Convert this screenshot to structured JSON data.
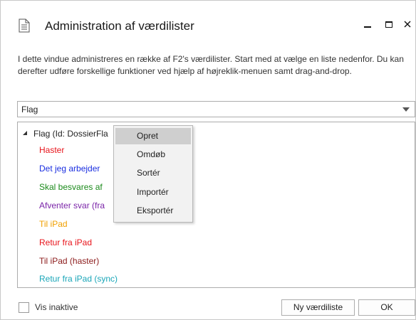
{
  "window": {
    "title": "Administration af værdilister",
    "doc_icon": "document-icon",
    "controls": {
      "minimize": "minimize-icon",
      "maximize": "maximize-icon",
      "close": "close-icon"
    }
  },
  "description": "I dette vindue administreres en række af F2's værdilister. Start med at vælge en liste nedenfor. Du kan derefter udføre forskellige funktioner ved hjælp af højreklik-menuen samt drag-and-drop.",
  "list_select": {
    "value": "Flag",
    "chevron_icon": "chevron-down-icon"
  },
  "tree": {
    "root_label": "Flag (Id: DossierFla",
    "toggle_icon": "expand-triangle-icon",
    "items": [
      {
        "label": "Haster",
        "color": "#e8141b"
      },
      {
        "label": "Det jeg arbejder",
        "color": "#1a2ee0"
      },
      {
        "label": "Skal besvares af",
        "color": "#1b8a1b"
      },
      {
        "label": "Afventer svar (fra",
        "color": "#7a23a8"
      },
      {
        "label": "Til iPad",
        "color": "#f0a000"
      },
      {
        "label": "Retur fra iPad",
        "color": "#e8141b"
      },
      {
        "label": "Til iPad (haster)",
        "color": "#8b1a1a"
      },
      {
        "label": "Retur fra iPad (sync)",
        "color": "#1aa6b8"
      }
    ]
  },
  "context_menu": {
    "items": [
      {
        "label": "Opret",
        "highlighted": true
      },
      {
        "label": "Omdøb",
        "highlighted": false
      },
      {
        "label": "Sortér",
        "highlighted": false
      },
      {
        "label": "Importér",
        "highlighted": false
      },
      {
        "label": "Eksportér",
        "highlighted": false
      }
    ]
  },
  "footer": {
    "show_inactive_label": "Vis inaktive",
    "show_inactive_checked": false,
    "new_list_label": "Ny værdiliste",
    "ok_label": "OK"
  }
}
